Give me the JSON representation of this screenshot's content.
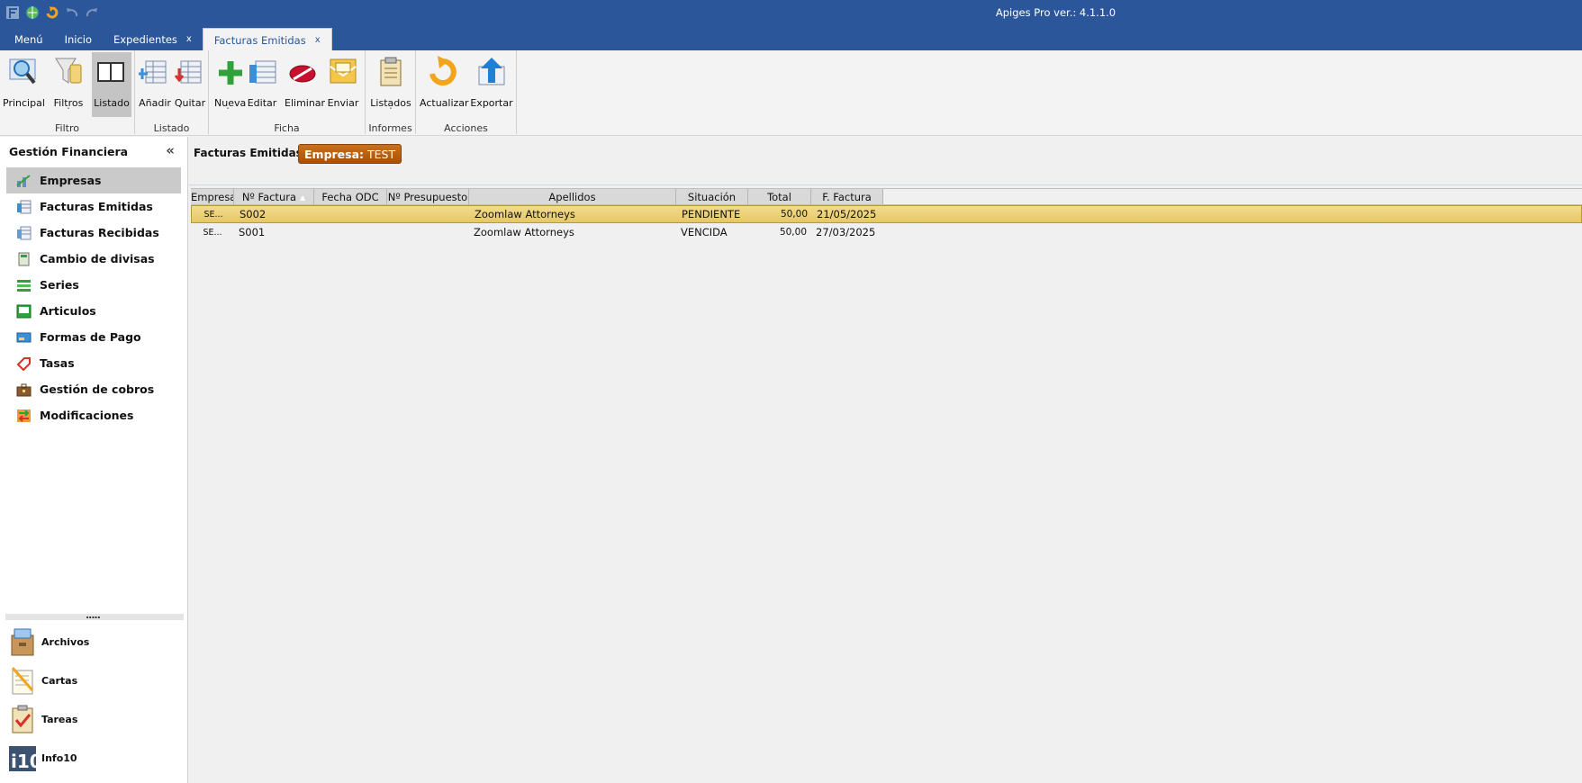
{
  "app_title": "Apiges Pro ver.: 4.1.1.0",
  "tabs": [
    {
      "label": "Menú"
    },
    {
      "label": "Inicio"
    },
    {
      "label": "Expedientes",
      "close": "x"
    },
    {
      "label": "Facturas Emitidas",
      "close": "x"
    }
  ],
  "ribbon": {
    "groups": {
      "filtro": "Filtro",
      "listado": "Listado",
      "ficha": "Ficha",
      "informes": "Informes",
      "acciones": "Acciones"
    },
    "buttons": {
      "principal": "Principal",
      "filtros": "Filtros",
      "listado": "Listado",
      "anadir": "Añadir",
      "quitar": "Quitar",
      "nueva": "Nueva",
      "editar": "Editar",
      "eliminar": "Eliminar",
      "enviar": "Enviar",
      "listados": "Listados",
      "actualizar": "Actualizar",
      "exportar": "Exportar"
    },
    "caret": "ˇ"
  },
  "sidebar": {
    "title": "Gestión Financiera",
    "collapse": "«",
    "items": [
      {
        "label": "Empresas"
      },
      {
        "label": "Facturas Emitidas"
      },
      {
        "label": "Facturas Recibidas"
      },
      {
        "label": "Cambio de divisas"
      },
      {
        "label": "Series"
      },
      {
        "label": "Articulos"
      },
      {
        "label": "Formas de Pago"
      },
      {
        "label": "Tasas"
      },
      {
        "label": "Gestión de cobros"
      },
      {
        "label": "Modificaciones"
      }
    ],
    "splitter_dots": ".....",
    "bottom": [
      {
        "label": "Archivos"
      },
      {
        "label": "Cartas"
      },
      {
        "label": "Tareas"
      },
      {
        "label": "Info10"
      }
    ]
  },
  "main": {
    "title": "Facturas Emitidas",
    "badge_key": "Empresa:",
    "badge_value": "TEST",
    "columns": [
      "Empresa",
      "Nº Factura",
      "Fecha ODC",
      "Nº Presupuesto",
      "Apellidos",
      "Situación",
      "Total",
      "F. Factura"
    ],
    "sort_arrow": "▲",
    "rows": [
      {
        "empresa": "SE...",
        "factura": "S002",
        "fecha_odc": "",
        "presupuesto": "",
        "apellidos": "Zoomlaw Attorneys",
        "situacion": "PENDIENTE",
        "total": "50,00",
        "fecha": "21/05/2025"
      },
      {
        "empresa": "SE...",
        "factura": "S001",
        "fecha_odc": "",
        "presupuesto": "",
        "apellidos": "Zoomlaw Attorneys",
        "situacion": "VENCIDA",
        "total": "50,00",
        "fecha": "27/03/2025"
      }
    ]
  }
}
